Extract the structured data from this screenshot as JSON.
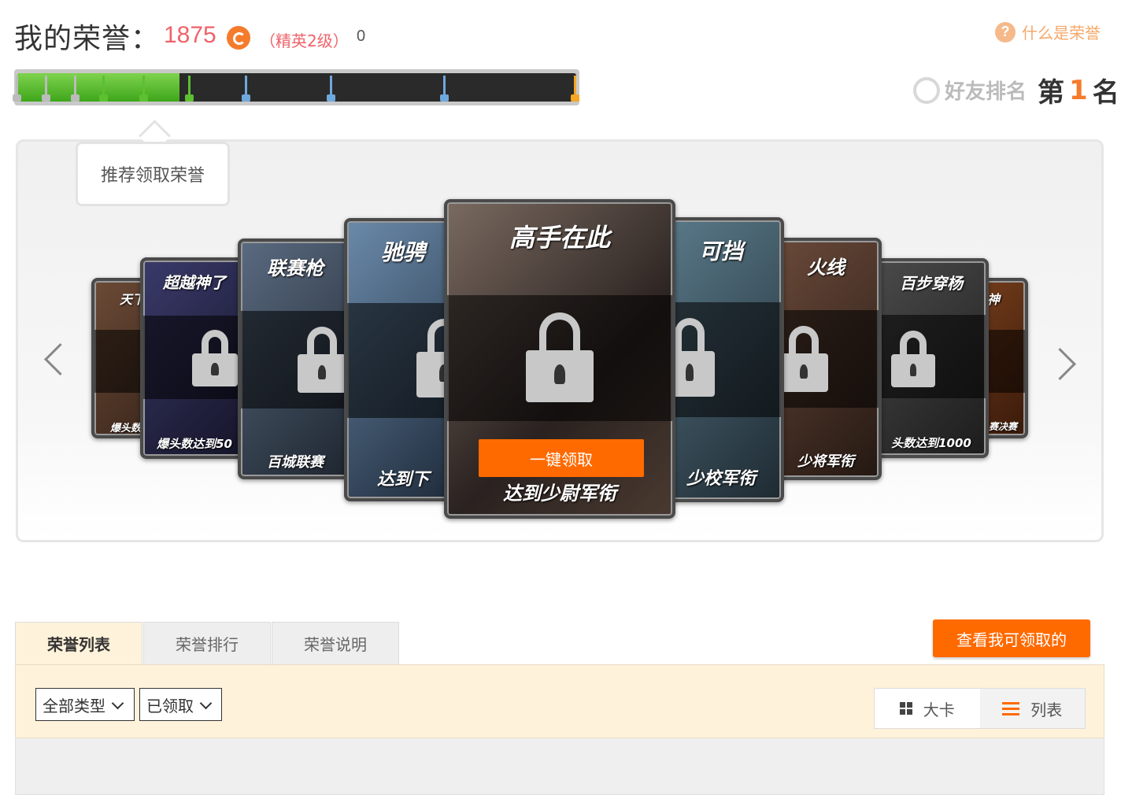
{
  "header": {
    "title": "我的荣誉：",
    "score": "1875",
    "level": "（精英2级）",
    "count": "0",
    "help_link": "什么是荣誉",
    "friend_rank_label": "好友排名",
    "rank_prefix": "第",
    "rank_value": "1",
    "rank_suffix": "名"
  },
  "progress": {
    "fraction": 0.29,
    "completed_ticks": 6,
    "total_ticks": 10
  },
  "carousel": {
    "tooltip": "推荐领取荣誉",
    "claim_button": "一键领取",
    "cards": [
      {
        "title": "天下",
        "subtitle": "爆头数"
      },
      {
        "title": "超越神了",
        "subtitle": "爆头数达到50"
      },
      {
        "title": "联赛枪",
        "subtitle": "百城联赛"
      },
      {
        "title": "驰骋",
        "subtitle": "达到下"
      },
      {
        "title": "高手在此",
        "subtitle": "达到少尉军衔"
      },
      {
        "title": "可挡",
        "subtitle": "少校军衔"
      },
      {
        "title": "火线",
        "subtitle": "少将军衔"
      },
      {
        "title": "百步穿杨",
        "subtitle": "头数达到1000"
      },
      {
        "title": "神",
        "subtitle": "赛决赛"
      }
    ]
  },
  "tabs": [
    {
      "label": "荣誉列表"
    },
    {
      "label": "荣誉排行"
    },
    {
      "label": "荣誉说明"
    }
  ],
  "view_claimable_button": "查看我可领取的",
  "filters": {
    "type_select": "全部类型",
    "status_select": "已领取"
  },
  "view_toggle": {
    "card_label": "大卡",
    "list_label": "列表"
  },
  "colors": {
    "accent": "#ff6a00",
    "score": "#f0626a",
    "progress_green": "#5cc030",
    "progress_blue": "#6fa8dc"
  }
}
